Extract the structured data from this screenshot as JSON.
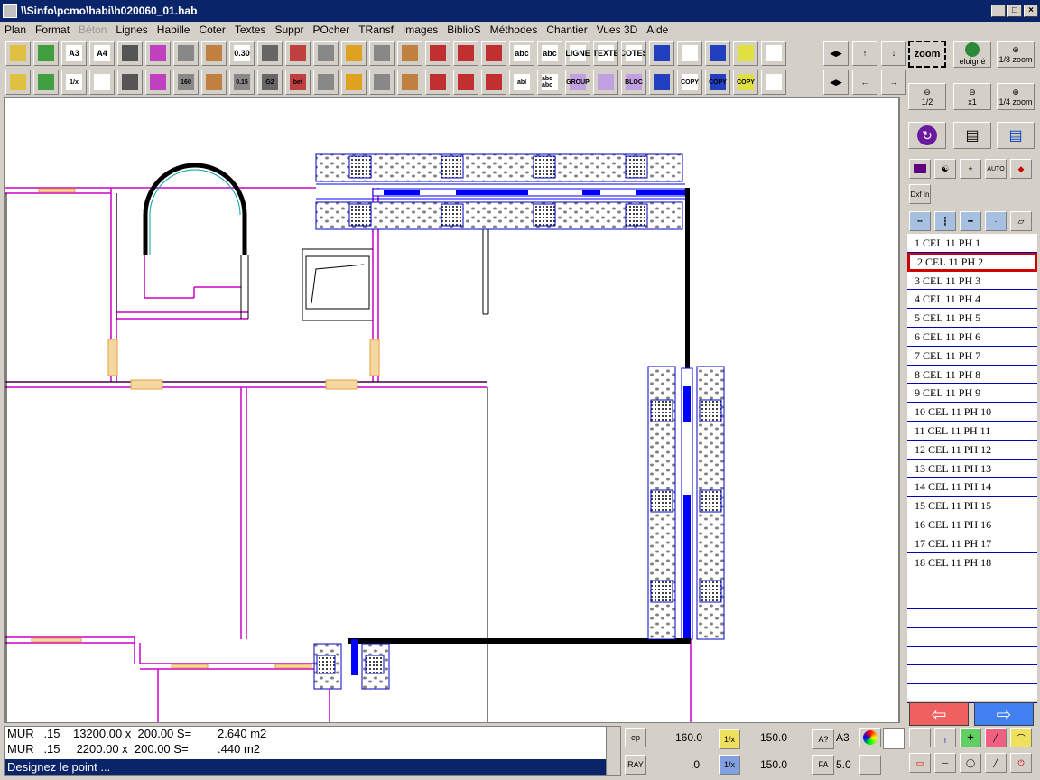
{
  "window": {
    "title": "\\\\Sinfo\\pcmo\\habi\\h020060_01.hab"
  },
  "menu": [
    "Plan",
    "Format",
    "Béton",
    "Lignes",
    "Habille",
    "Coter",
    "Textes",
    "Suppr",
    "POcher",
    "TRansf",
    "Images",
    "BiblioS",
    "Méthodes",
    "Chantier",
    "Vues 3D",
    "Aide"
  ],
  "menu_disabled": [
    "Béton"
  ],
  "toolbar": {
    "row1_labels": [
      "A3",
      "A4",
      "0.30",
      "abc",
      "abc",
      "LIGNE",
      "TEXTE",
      "COTES"
    ],
    "row2_labels": [
      "1/x",
      "160",
      "0.15",
      "G2",
      "bet",
      "abI",
      "abc abc",
      "GROUP",
      "BLOC",
      "COPY",
      "COPY",
      "COPY"
    ],
    "zoom_label": "zoom",
    "eloigne_label": "eloigné",
    "zoom_1_8": "1/8 zoom",
    "zoom_1_2": "1/2",
    "zoom_x1": "x1",
    "zoom_1_4": "1/4 zoom",
    "dxf_label": "Dxf In",
    "auto_label": "AUTO"
  },
  "sidebar": {
    "items": [
      "1 CEL 11 PH  1",
      "2 CEL 11 PH  2",
      "3 CEL 11 PH  3",
      "4 CEL 11 PH  4",
      "5 CEL 11 PH  5",
      "6 CEL 11 PH  6",
      "7 CEL 11 PH  7",
      "8 CEL 11 PH  8",
      "9 CEL 11 PH  9",
      "10 CEL 11 PH 10",
      "11 CEL 11 PH 11",
      "12 CEL 11 PH 12",
      "13 CEL 11 PH 13",
      "14 CEL 11 PH 14",
      "15 CEL 11 PH 15",
      "16 CEL 11 PH 16",
      "17 CEL 11 PH 17",
      "18 CEL 11 PH 18",
      "",
      "",
      "",
      "",
      "",
      "",
      ""
    ],
    "selected_index": 1
  },
  "status": {
    "lines": [
      "MUR   .15    13200.00 x  200.00 S=        2.640 m2",
      "MUR   .15     2200.00 x  200.00 S=         .440 m2"
    ],
    "prompt": "Designez le point ..."
  },
  "params": {
    "ep_label": "ep",
    "ray_label": "RAY",
    "ep_value": "160.0",
    "ray_value": ".0",
    "v1": "150.0",
    "v2": "150.0",
    "a3_label": "A3",
    "fa_label": "FA",
    "fa_value": "5.0",
    "a_q_label": "A?",
    "fa_btn": "FA"
  },
  "colors": {
    "title_bg": "#0a246a",
    "selection": "#d00000",
    "wall_magenta": "#cc00cc",
    "wall_blue": "#0000ff",
    "window_orange": "#e8a040"
  }
}
